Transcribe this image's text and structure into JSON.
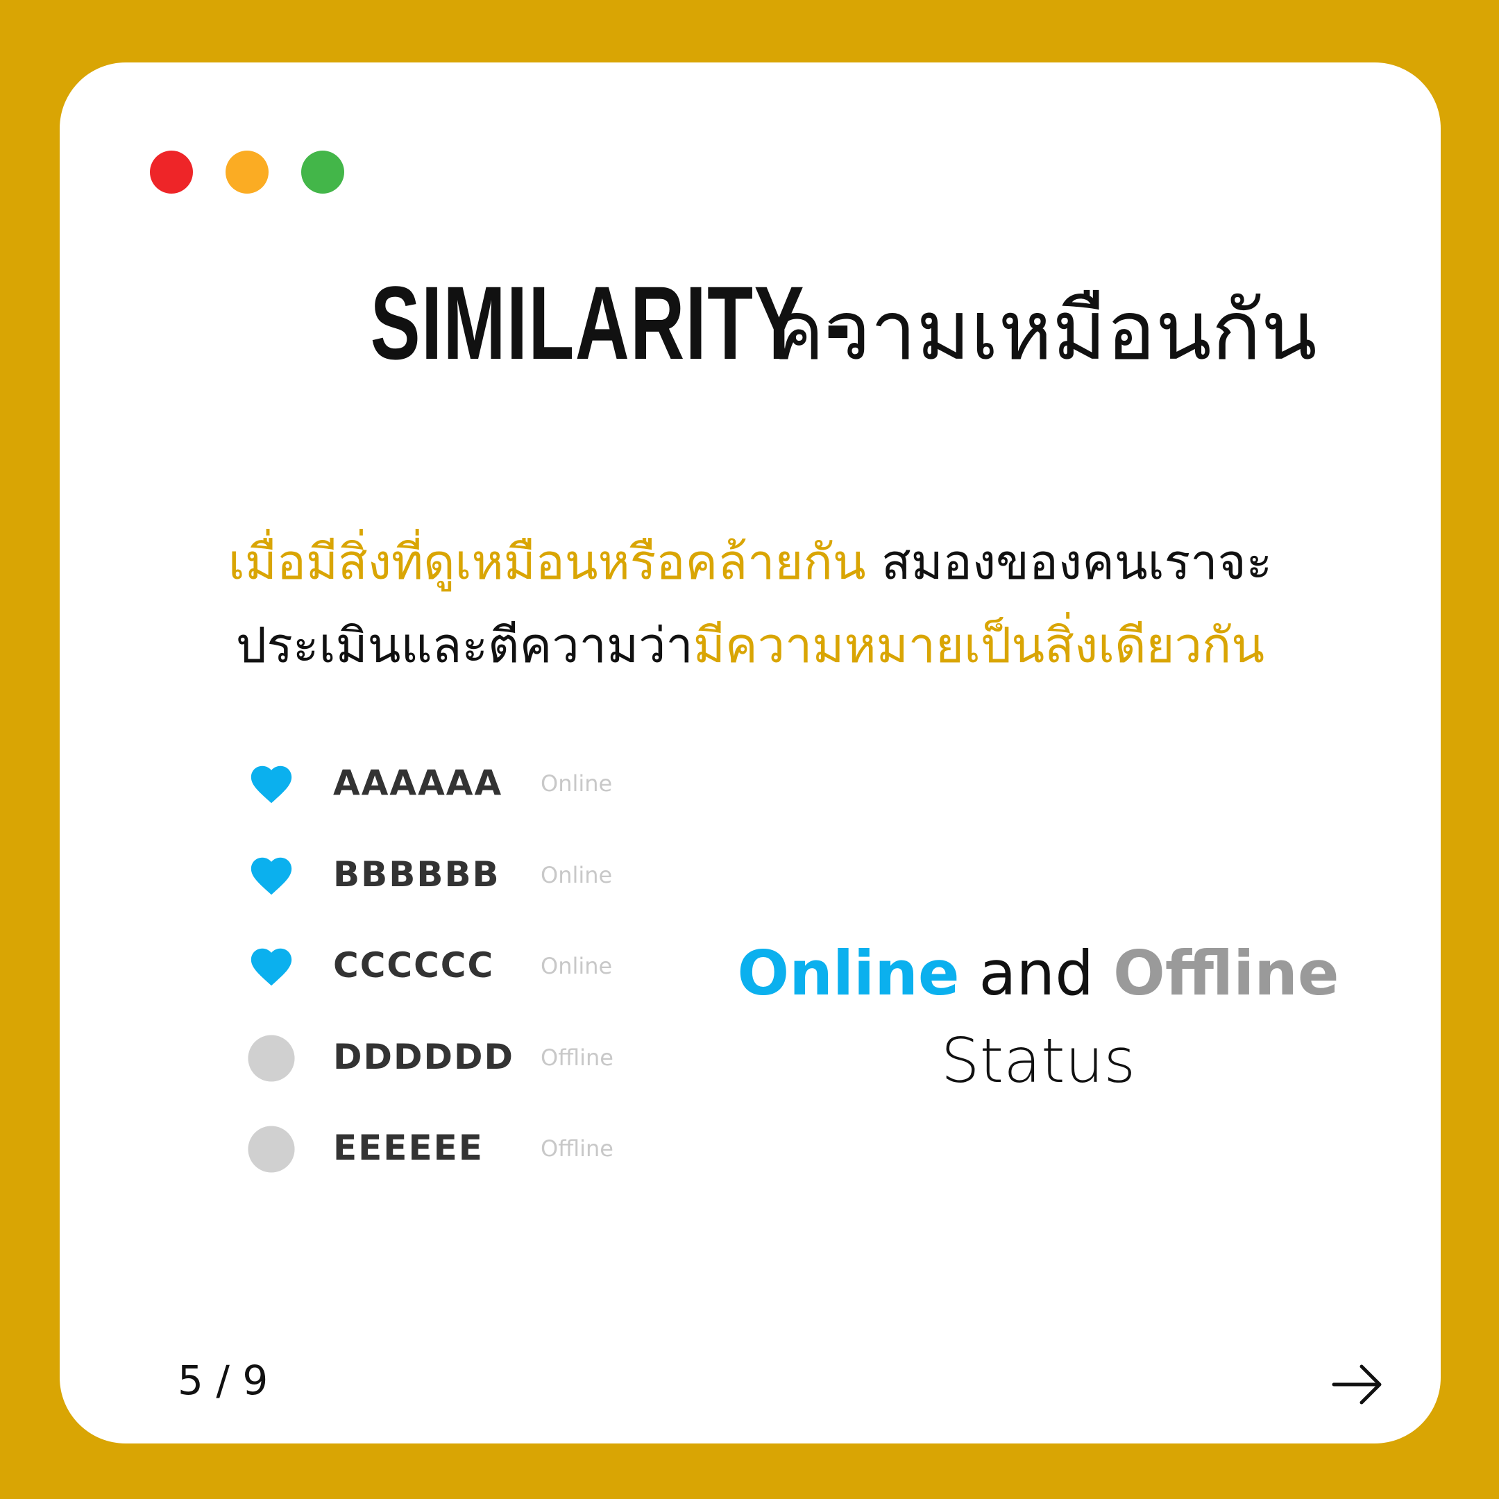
{
  "window": {
    "controls": [
      {
        "name": "close",
        "color": "#EE2528"
      },
      {
        "name": "minimize",
        "color": "#FBAC23"
      },
      {
        "name": "maximize",
        "color": "#43B649"
      }
    ]
  },
  "title": {
    "english": "SIMILARITY - ",
    "thai": "ความเหมือนกัน"
  },
  "subtitle": {
    "line1_highlight": "เมื่อมีสิ่งที่ดูเหมือนหรือคล้ายกัน",
    "line1_rest": " สมองของคนเราจะ",
    "line2_rest": "ประเมินและตีความว่า",
    "line2_highlight": "มีความหมายเป็นสิ่งเดียวกัน"
  },
  "users": [
    {
      "name": "AAAAAA",
      "status": "Online",
      "icon": "heart-icon"
    },
    {
      "name": "BBBBBB",
      "status": "Online",
      "icon": "heart-icon"
    },
    {
      "name": "CCCCCC",
      "status": "Online",
      "icon": "heart-icon"
    },
    {
      "name": "DDDDDD",
      "status": "Offline",
      "icon": "circle-icon"
    },
    {
      "name": "EEEEEE",
      "status": "Offline",
      "icon": "circle-icon"
    }
  ],
  "legend": {
    "online": "Online",
    "and": " and ",
    "offline": "Offline",
    "status": "Status"
  },
  "pager": {
    "text": "5 / 9"
  },
  "colors": {
    "accent": "#D9A504",
    "online": "#0BB0EE",
    "offline_icon": "#D0D0D0",
    "offline_text": "#9A9A9A"
  }
}
